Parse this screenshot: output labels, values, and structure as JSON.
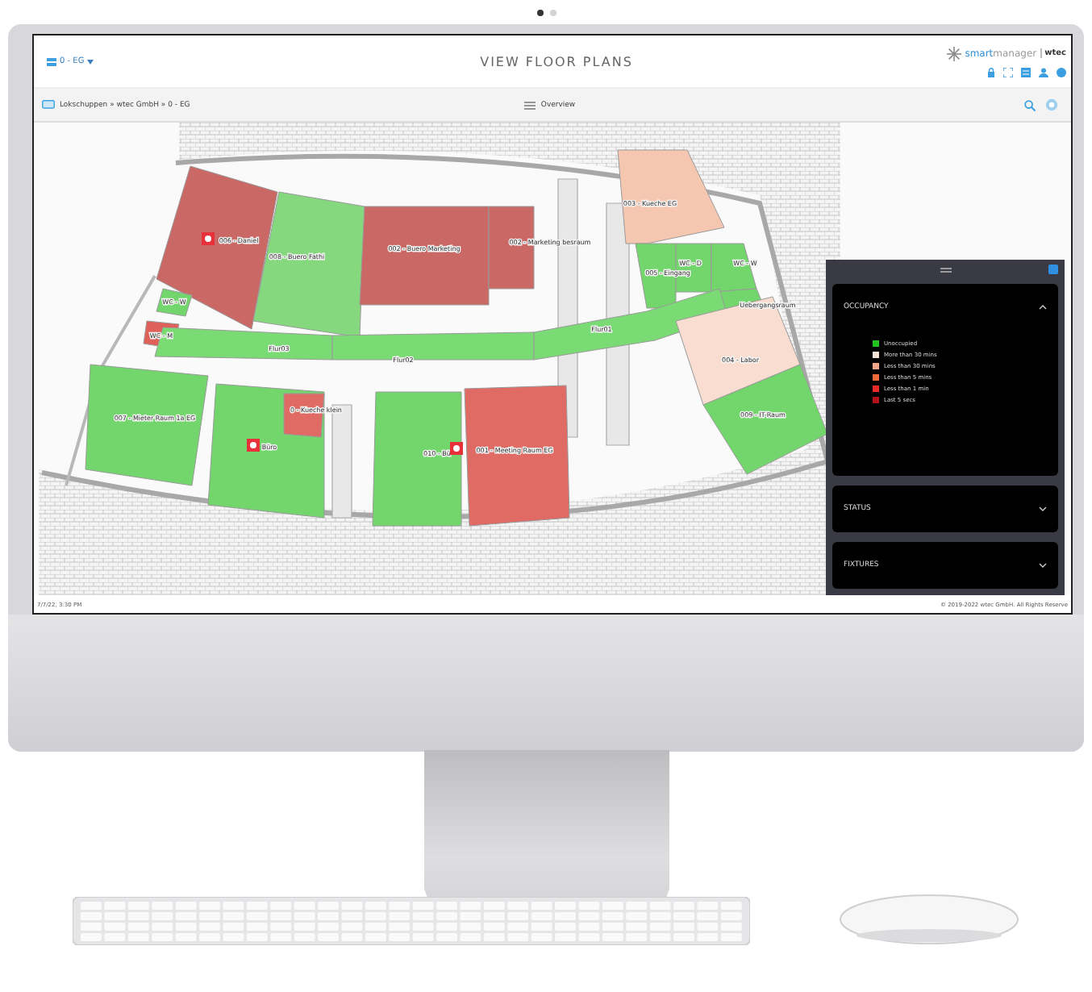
{
  "carousel": [
    {
      "selected": true
    },
    {
      "selected": false
    }
  ],
  "header": {
    "floor_select": "0 - EG",
    "title": "VIEW FLOOR PLANS",
    "logo_prefix": "smart",
    "logo_suffix": "manager",
    "brand": "wtec"
  },
  "breadcrumb": "Lokschuppen » wtec GmbH » 0 - EG",
  "view": "Overview",
  "rooms": [
    {
      "label": "006 - Daniel",
      "color": "#c96864",
      "marker": true
    },
    {
      "label": "008 - Buero Fathi",
      "color": "#85d87e",
      "marker": false
    },
    {
      "label": "002 - Buero Marketing",
      "color": "#c96864",
      "marker": false
    },
    {
      "label": "002 - Marketing besraum",
      "color": "#c96864",
      "marker": false
    },
    {
      "label": "003 - Kueche EG",
      "color": "#f5c6b0",
      "marker": false
    },
    {
      "label": "005 - Eingang",
      "color": "#72d66c",
      "marker": false
    },
    {
      "label": "WC - D",
      "color": "#72d66c",
      "marker": false
    },
    {
      "label": "WC - W",
      "color": "#72d66c",
      "marker": false
    },
    {
      "label": "Uebergangsraum",
      "color": "#72d66c",
      "marker": false
    },
    {
      "label": "WC - W",
      "color": "#72d66c",
      "marker": false
    },
    {
      "label": "WC - M",
      "color": "#e0605a",
      "marker": false
    },
    {
      "label": "Flur03",
      "color": "#7ada74",
      "marker": false
    },
    {
      "label": "Flur02",
      "color": "#7ada74",
      "marker": false
    },
    {
      "label": "Flur01",
      "color": "#7ada74",
      "marker": false
    },
    {
      "label": "007 - Mieter Raum 1a EG",
      "color": "#72d66c",
      "marker": false
    },
    {
      "label": "Büro",
      "color": "#72d66c",
      "marker": true
    },
    {
      "label": "0 - Kueche klein",
      "color": "#e06a64",
      "marker": false
    },
    {
      "label": "010 - Bü",
      "color": "#72d66c",
      "marker": false
    },
    {
      "label": "001 - Meeting Raum EG",
      "color": "#e06a64",
      "marker": true
    },
    {
      "label": "004 - Labor",
      "color": "#f8ddd0",
      "marker": false
    },
    {
      "label": "009 - IT-Raum",
      "color": "#72d66c",
      "marker": false
    }
  ],
  "panel": {
    "sections": [
      {
        "title": "OCCUPANCY",
        "expanded": true,
        "legend": [
          {
            "label": "Unoccupied",
            "color": "#1fc21f"
          },
          {
            "label": "More than 30 mins",
            "color": "#f2e4d6"
          },
          {
            "label": "Less than 30 mins",
            "color": "#f0a48a"
          },
          {
            "label": "Less than 5 mins",
            "color": "#f06a3a"
          },
          {
            "label": "Less than 1 min",
            "color": "#ec2a2a"
          },
          {
            "label": "Last 5 secs",
            "color": "#b3121b"
          }
        ]
      },
      {
        "title": "STATUS",
        "expanded": false
      },
      {
        "title": "FIXTURES",
        "expanded": false
      }
    ]
  },
  "footer": {
    "timestamp": "7/7/22, 3:30 PM",
    "copyright": "© 2019-2022 wtec GmbH. All Rights Reserve"
  }
}
